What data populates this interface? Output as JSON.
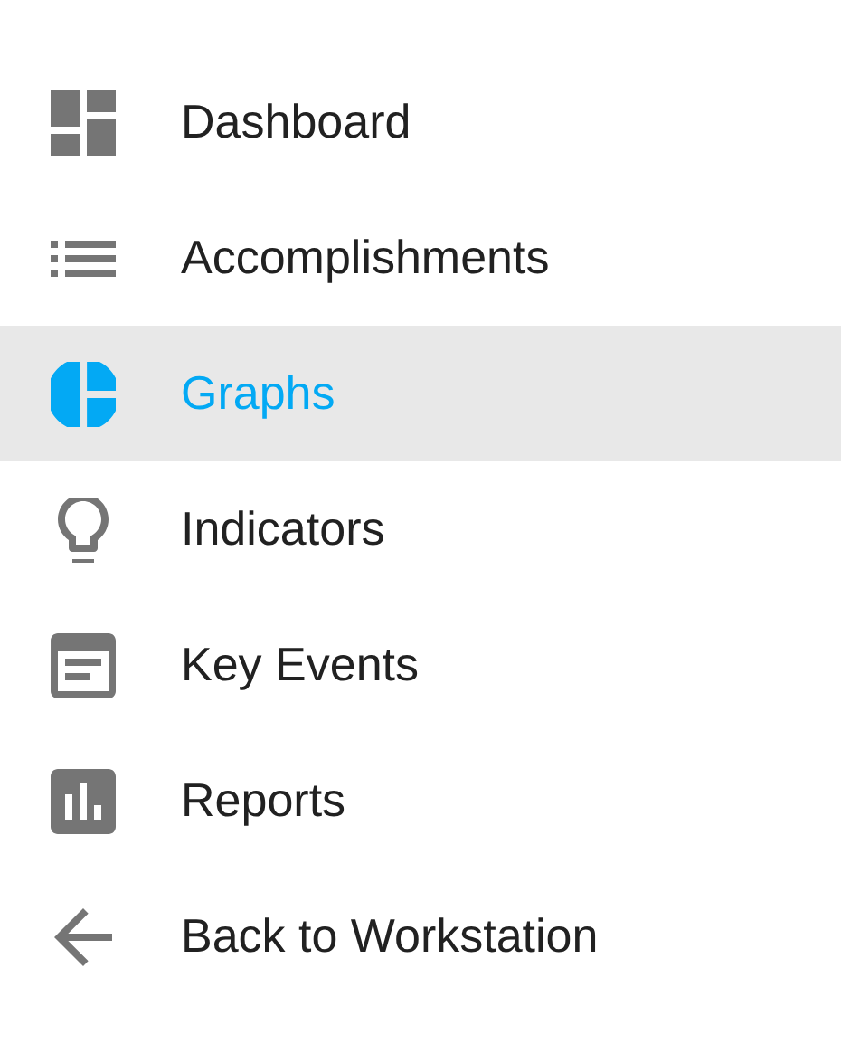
{
  "menu": [
    {
      "label": "Dashboard",
      "kind": "dashboard",
      "selected": false
    },
    {
      "label": "Accomplishments",
      "kind": "list",
      "selected": false
    },
    {
      "label": "Graphs",
      "kind": "pie",
      "selected": true
    },
    {
      "label": "Indicators",
      "kind": "bulb",
      "selected": false
    },
    {
      "label": "Key Events",
      "kind": "event",
      "selected": false
    },
    {
      "label": "Reports",
      "kind": "report",
      "selected": false
    },
    {
      "label": "Back to Workstation",
      "kind": "back",
      "selected": false
    }
  ]
}
